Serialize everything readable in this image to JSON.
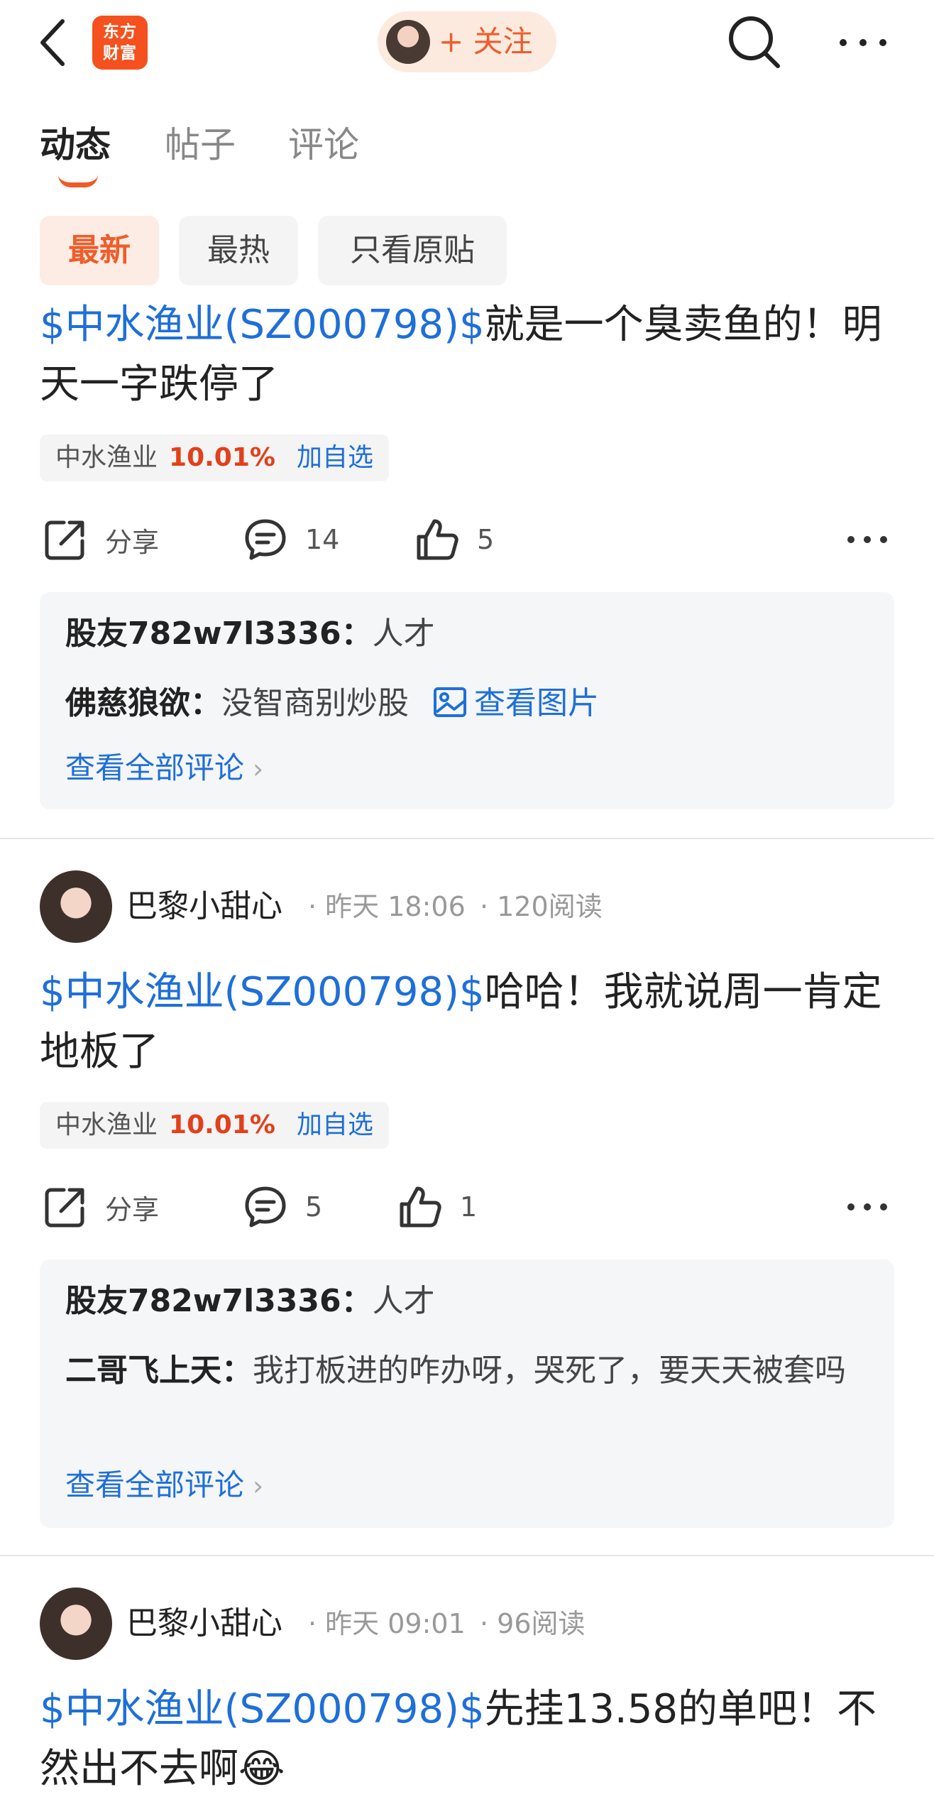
{
  "header": {
    "logo_line1": "东方",
    "logo_line2": "财富",
    "follow_label": "+ 关注",
    "accent_color": "#ee5d2a",
    "icons": [
      "back-icon",
      "search-icon",
      "more-icon"
    ]
  },
  "tabs": [
    {
      "label": "动态",
      "active": true
    },
    {
      "label": "帖子",
      "active": false
    },
    {
      "label": "评论",
      "active": false
    }
  ],
  "filters": [
    {
      "label": "最新",
      "active": true
    },
    {
      "label": "最热",
      "active": false
    },
    {
      "label": "只看原贴",
      "active": false
    }
  ],
  "posts": [
    {
      "stock_link": "$中水渔业(SZ000798)$",
      "text": "就是一个臭卖鱼的！明天一字跌停了",
      "tag": {
        "name": "中水渔业",
        "pct": "10.01%",
        "add": "加自选"
      },
      "actions": {
        "share": "分享",
        "comments": "14",
        "likes": "5"
      },
      "comments": [
        {
          "user": "股友782w7l3336：",
          "text": "人才"
        },
        {
          "user": "佛慈狼欲：",
          "text": "没智商别炒股",
          "image_link": "查看图片"
        }
      ],
      "view_all": "查看全部评论"
    },
    {
      "author": "巴黎小甜心",
      "time": "· 昨天 18:06",
      "reads": "· 120阅读",
      "stock_link": "$中水渔业(SZ000798)$",
      "text": "哈哈！我就说周一肯定地板了",
      "tag": {
        "name": "中水渔业",
        "pct": "10.01%",
        "add": "加自选"
      },
      "actions": {
        "share": "分享",
        "comments": "5",
        "likes": "1"
      },
      "comments": [
        {
          "user": "股友782w7l3336：",
          "text": "人才"
        },
        {
          "user": "二哥飞上天：",
          "text": "我打板进的咋办呀，哭死了，要天天被套吗"
        }
      ],
      "view_all": "查看全部评论"
    },
    {
      "author": "巴黎小甜心",
      "time": "· 昨天 09:01",
      "reads": "· 96阅读",
      "stock_link": "$中水渔业(SZ000798)$",
      "text": "先挂13.58的单吧！不然出不去啊😂"
    }
  ]
}
